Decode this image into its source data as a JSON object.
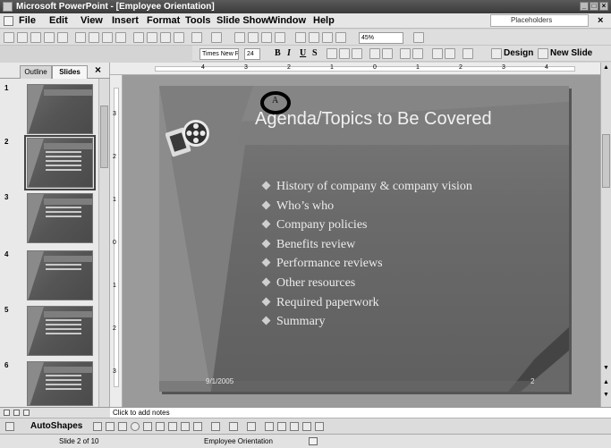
{
  "window": {
    "title": "Microsoft PowerPoint - [Employee Orientation]"
  },
  "menu": {
    "items": [
      "File",
      "Edit",
      "View",
      "Insert",
      "Format",
      "Tools",
      "Slide Show",
      "Window",
      "Help"
    ],
    "help_box": "Placeholders",
    "doc_close": "×"
  },
  "toolbar": {
    "zoom": "45%",
    "font": "Times New Roman",
    "font_size": "24",
    "bold": "B",
    "italic": "I",
    "underline": "U",
    "shadow": "S",
    "design_label": "Design",
    "new_slide_label": "New Slide"
  },
  "left_panel": {
    "tabs": [
      "Outline",
      "Slides"
    ],
    "active_tab": "Slides",
    "close": "×",
    "slide_numbers": [
      "1",
      "2",
      "3",
      "4",
      "5",
      "6"
    ],
    "selected_slide": "2"
  },
  "ruler": {
    "h_numbers": [
      "4",
      "3",
      "2",
      "1",
      "0",
      "1",
      "2",
      "3",
      "4"
    ],
    "v_numbers": [
      "3",
      "2",
      "1",
      "0",
      "1",
      "2",
      "3"
    ]
  },
  "slide": {
    "title": "Agenda/Topics to Be Covered",
    "bullets": [
      "History of company & company vision",
      "Who’s who",
      "Company policies",
      "Benefits review",
      "Performance reviews",
      "Other resources",
      "Required paperwork",
      "Summary"
    ],
    "date": "9/1/2005",
    "number": "2",
    "cursor_label": "A"
  },
  "notes": {
    "placeholder": "Click to add notes"
  },
  "drawing": {
    "autoshapes_label": "AutoShapes"
  },
  "status": {
    "slide_info": "Slide 2 of 10",
    "design_name": "Employee Orientation"
  }
}
